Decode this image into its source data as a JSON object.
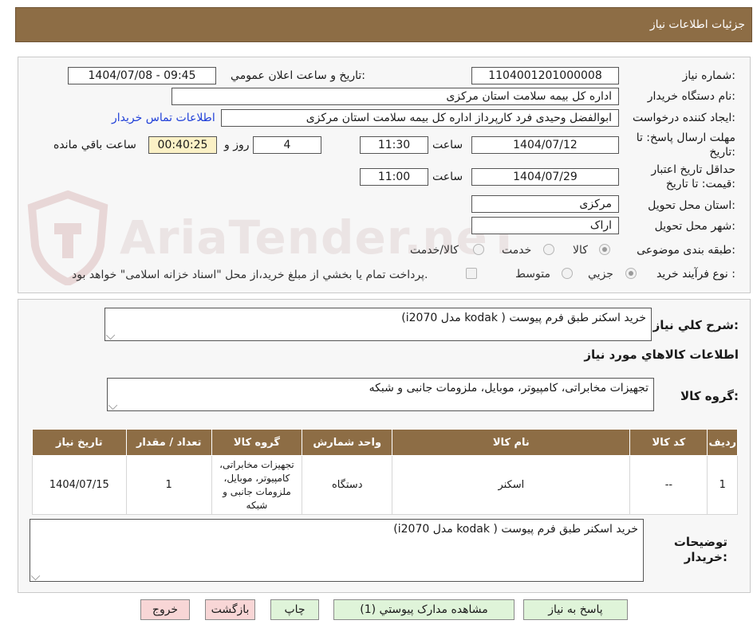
{
  "header": {
    "title": "جزئيات اطلاعات نياز"
  },
  "watermark": {
    "text": "AriaTender.neT"
  },
  "fields": {
    "need_number_label": "شماره نياز:",
    "need_number": "1104001201000008",
    "announce_label": "تاريخ و ساعت اعلان عمومي:",
    "announce_value": "1404/07/08 - 09:45",
    "buyer_label": "نام دستگاه خريدار:",
    "buyer": "اداره کل بیمه سلامت استان مرکزی",
    "creator_label": "ايجاد کننده درخواست:",
    "creator": "ابوالفضل  وحیدی فرد  کارپرداز اداره کل بیمه سلامت استان مرکزی",
    "contact_link": "اطلاعات تماس خريدار",
    "deadline_label_1": "مهلت ارسال پاسخ: تا",
    "deadline_label_2": "تاريخ:",
    "deadline_date": "1404/07/12",
    "time_label": "ساعت",
    "deadline_time": "11:30",
    "days": "4",
    "days_label": "روز و",
    "remaining": "00:40:25",
    "remaining_label": "ساعت باقي مانده",
    "validity_label_1": "حداقل تاريخ اعتبار",
    "validity_label_2": "قيمت: تا تاريخ:",
    "validity_date": "1404/07/29",
    "validity_time": "11:00",
    "province_label": "استان محل تحويل:",
    "province": "مرکزی",
    "city_label": "شهر محل تحويل:",
    "city": "اراک",
    "category_label": "طبقه بندی موضوعی:",
    "category_options": [
      "کالا",
      "خدمت",
      "کالا/خدمت"
    ],
    "process_label": "نوع فرآيند خريد :",
    "process_options": [
      "جزيي",
      "متوسط"
    ],
    "payment_note": "پرداخت تمام يا بخشي از مبلغ خريد،از محل \"اسناد خزانه اسلامی\" خواهد بود."
  },
  "summary": {
    "label": "شرح کلي نياز:",
    "text": "خرید اسکنر طبق فرم پیوست ( kodak مدل i2070)",
    "goods_title": "اطلاعات کالاهاي مورد نياز",
    "group_label": "گروه کالا:",
    "group_text": "تجهیزات مخابراتی، کامپیوتر، موبایل، ملزومات جانبی و شبکه"
  },
  "table": {
    "headers": [
      "رديف",
      "کد کالا",
      "نام کالا",
      "واحد شمارش",
      "گروه کالا",
      "تعداد / مقدار",
      "تاريخ نياز"
    ],
    "rows": [
      [
        "1",
        "--",
        "اسکنر",
        "دستگاه",
        "تجهيزات مخابراتی، کامپیوتر، موبایل، ملزومات جانبی و شبکه",
        "1",
        "1404/07/15"
      ]
    ]
  },
  "buyer_notes": {
    "label_1": "توضيحات",
    "label_2": "خريدار:",
    "text": "خرید اسکنر طبق فرم پیوست ( kodak مدل i2070)"
  },
  "buttons": {
    "reply": "پاسخ به نياز",
    "attachments": "مشاهده مدارک پيوستي (1)",
    "print": "چاپ",
    "back": "بازگشت",
    "exit": "خروج"
  },
  "colors": {
    "header_bg": "#8d6d45",
    "link": "#1f3fd8",
    "button_green": "#dff4d9",
    "button_red": "#f8d6d6"
  }
}
